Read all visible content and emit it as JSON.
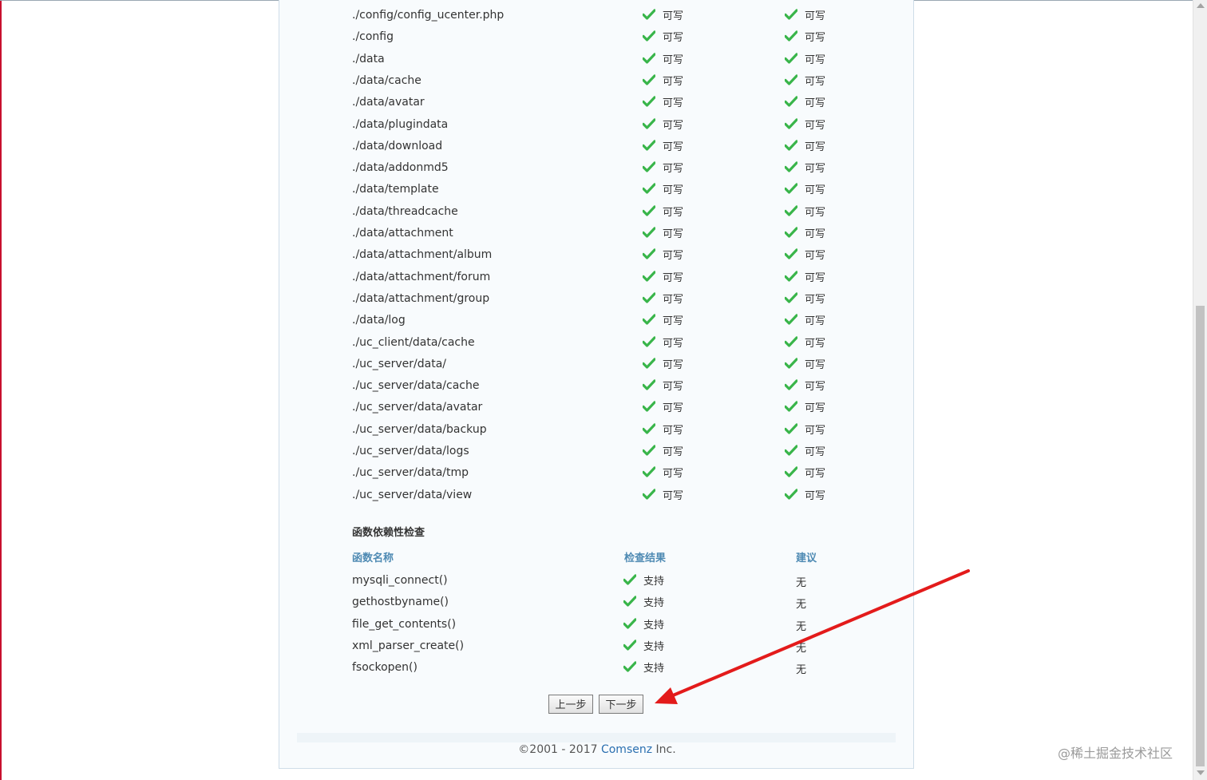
{
  "permissions": {
    "status_label": "可写",
    "rows": [
      "./config/config_ucenter.php",
      "./config",
      "./data",
      "./data/cache",
      "./data/avatar",
      "./data/plugindata",
      "./data/download",
      "./data/addonmd5",
      "./data/template",
      "./data/threadcache",
      "./data/attachment",
      "./data/attachment/album",
      "./data/attachment/forum",
      "./data/attachment/group",
      "./data/log",
      "./uc_client/data/cache",
      "./uc_server/data/",
      "./uc_server/data/cache",
      "./uc_server/data/avatar",
      "./uc_server/data/backup",
      "./uc_server/data/logs",
      "./uc_server/data/tmp",
      "./uc_server/data/view"
    ]
  },
  "functions": {
    "section_title": "函数依赖性检查",
    "headers": {
      "name": "函数名称",
      "result": "检查结果",
      "advice": "建议"
    },
    "rows": [
      {
        "name": "mysqli_connect()",
        "result": "支持",
        "advice": "无"
      },
      {
        "name": "gethostbyname()",
        "result": "支持",
        "advice": "无"
      },
      {
        "name": "file_get_contents()",
        "result": "支持",
        "advice": "无"
      },
      {
        "name": "xml_parser_create()",
        "result": "支持",
        "advice": "无"
      },
      {
        "name": "fsockopen()",
        "result": "支持",
        "advice": "无"
      }
    ]
  },
  "buttons": {
    "prev": "上一步",
    "next": "下一步"
  },
  "footer": {
    "prefix": "©2001 - 2017 ",
    "company": "Comsenz",
    "suffix": " Inc."
  },
  "watermark": "@稀土掘金技术社区",
  "colors": {
    "check": "#39b54a",
    "header": "#4e8ab3",
    "arrow": "#e31b1b",
    "link": "#2a6fb0"
  }
}
